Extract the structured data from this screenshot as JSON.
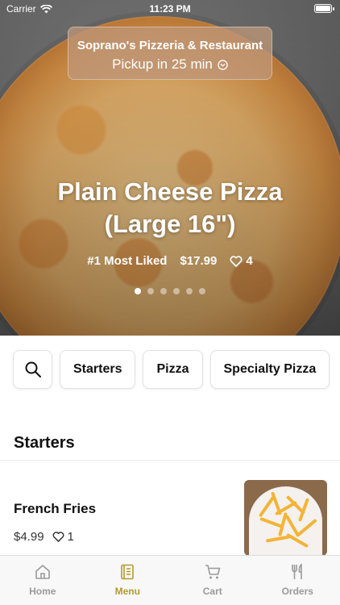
{
  "status_bar": {
    "carrier": "Carrier",
    "time": "11:23 PM"
  },
  "restaurant": {
    "name": "Soprano's Pizzeria & Restaurant",
    "pickup": "Pickup in 25 min"
  },
  "hero": {
    "title_line1": "Plain Cheese Pizza",
    "title_line2": "(Large 16\")",
    "rank": "#1 Most Liked",
    "price": "$17.99",
    "likes": "4",
    "slide_count": 6,
    "active_slide": 1
  },
  "categories": [
    "Starters",
    "Pizza",
    "Specialty Pizza"
  ],
  "section": {
    "title": "Starters"
  },
  "items": [
    {
      "name": "French Fries",
      "price": "$4.99",
      "likes": "1"
    }
  ],
  "tabs": [
    {
      "label": "Home",
      "icon": "home-icon"
    },
    {
      "label": "Menu",
      "icon": "menu-icon",
      "active": true
    },
    {
      "label": "Cart",
      "icon": "cart-icon"
    },
    {
      "label": "Orders",
      "icon": "utensils-icon"
    }
  ],
  "colors": {
    "accent": "#b59b2a",
    "inactive": "#9a9a9a"
  }
}
